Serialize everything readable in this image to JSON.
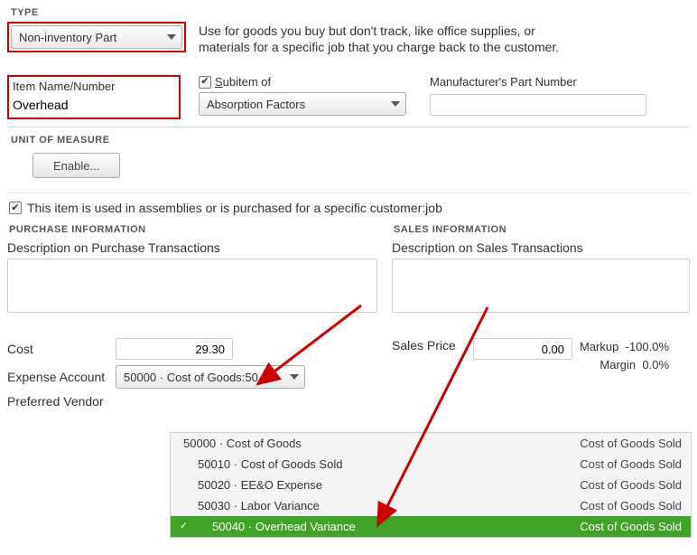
{
  "type_section_label": "TYPE",
  "type_value": "Non-inventory Part",
  "type_description": "Use for goods you buy but don't track, like office supplies, or materials for a specific job that you charge back to the customer.",
  "item_name_label": "Item Name/Number",
  "item_name_value": "Overhead",
  "subitem_label_prefix": "S",
  "subitem_label_rest": "ubitem of",
  "subitem_value": "Absorption Factors",
  "mfr_label": "Manufacturer's Part Number",
  "mfr_value": "",
  "uom_label": "UNIT OF MEASURE",
  "enable_button": "Enable...",
  "assembly_text": "This item is used in assemblies or is purchased for a specific customer:job",
  "purchase_header": "PURCHASE INFORMATION",
  "sales_header": "SALES INFORMATION",
  "purchase_desc_label": "Description on Purchase Transactions",
  "sales_desc_label": "Description on Sales Transactions",
  "cost_label": "Cost",
  "cost_value": "29.30",
  "sales_price_label": "Sales Price",
  "sales_price_value": "0.00",
  "expense_label": "Expense Account",
  "expense_value": "50000 · Cost of Goods:50",
  "vendor_label": "Preferred Vendor",
  "markup_label": "Markup",
  "markup_value": "-100.0%",
  "margin_label": "Margin",
  "margin_value": "0.0%",
  "dropdown": {
    "items": [
      {
        "code": "50000 · Cost of Goods",
        "type": "Cost of Goods Sold",
        "level": 0
      },
      {
        "code": "50010 · Cost of Goods Sold",
        "type": "Cost of Goods Sold",
        "level": 1
      },
      {
        "code": "50020 · EE&O Expense",
        "type": "Cost of Goods Sold",
        "level": 1
      },
      {
        "code": "50030 · Labor Variance",
        "type": "Cost of Goods Sold",
        "level": 1
      },
      {
        "code": "50040 · Overhead Variance",
        "type": "Cost of Goods Sold",
        "level": 1,
        "selected": true
      }
    ]
  }
}
